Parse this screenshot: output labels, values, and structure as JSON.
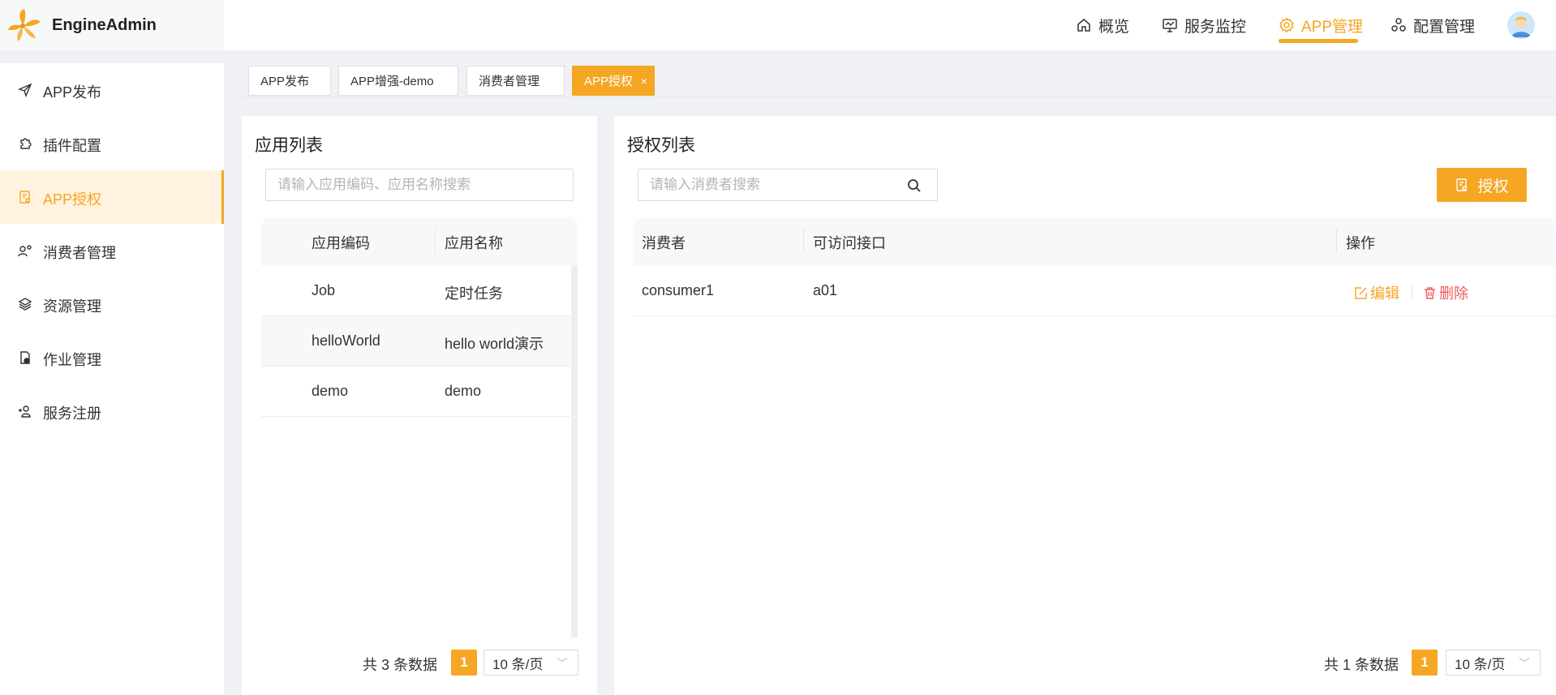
{
  "brand": {
    "name": "EngineAdmin",
    "logo_icon": "engine-logo-icon",
    "color": "#f5a623"
  },
  "topnav": {
    "items": [
      {
        "label": "概览",
        "icon": "home-icon"
      },
      {
        "label": "服务监控",
        "icon": "monitor-icon"
      },
      {
        "label": "APP管理",
        "icon": "gear-icon",
        "active": true
      },
      {
        "label": "配置管理",
        "icon": "cluster-icon"
      }
    ],
    "avatar_icon": "user-avatar-icon"
  },
  "sidebar": {
    "items": [
      {
        "label": "APP发布",
        "icon": "send-icon"
      },
      {
        "label": "插件配置",
        "icon": "puzzle-icon"
      },
      {
        "label": "APP授权",
        "icon": "authorize-doc-icon",
        "active": true
      },
      {
        "label": "消费者管理",
        "icon": "users-gear-icon"
      },
      {
        "label": "资源管理",
        "icon": "layers-icon"
      },
      {
        "label": "作业管理",
        "icon": "job-file-icon"
      },
      {
        "label": "服务注册",
        "icon": "user-add-icon"
      }
    ]
  },
  "tabs": [
    {
      "label": "APP发布"
    },
    {
      "label": "APP增强-demo"
    },
    {
      "label": "消费者管理"
    },
    {
      "label": "APP授权",
      "active": true,
      "close": "×"
    }
  ],
  "app_panel": {
    "title": "应用列表",
    "search_placeholder": "请输入应用编码、应用名称搜索",
    "columns": [
      "应用编码",
      "应用名称"
    ],
    "rows": [
      {
        "code": "Job",
        "name": "定时任务"
      },
      {
        "code": "helloWorld",
        "name": "hello world演示"
      },
      {
        "code": "demo",
        "name": "demo"
      }
    ],
    "pager": {
      "total": "共 3 条数据",
      "page": "1",
      "size": "10 条/页"
    }
  },
  "auth_panel": {
    "title": "授权列表",
    "search_placeholder": "请输入消费者搜索",
    "authorize_button": "授权",
    "columns": [
      "消费者",
      "可访问接口",
      "操作"
    ],
    "rows": [
      {
        "consumer": "consumer1",
        "api": "a01",
        "edit": "编辑",
        "delete": "删除"
      }
    ],
    "pager": {
      "total": "共 1 条数据",
      "page": "1",
      "size": "10 条/页"
    }
  },
  "colors": {
    "accent": "#f5a623",
    "danger": "#f05a5a",
    "bg": "#f0f1f5"
  }
}
